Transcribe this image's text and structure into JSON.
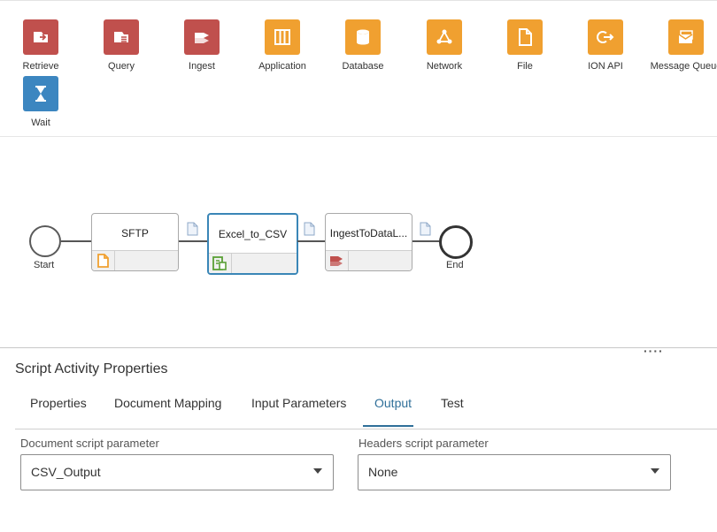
{
  "palette": {
    "items": [
      {
        "label": "Retrieve",
        "icon": "retrieve-icon",
        "color": "#c0504d"
      },
      {
        "label": "Query",
        "icon": "query-icon",
        "color": "#c0504d"
      },
      {
        "label": "Ingest",
        "icon": "ingest-icon",
        "color": "#c0504d"
      },
      {
        "label": "Application",
        "icon": "application-icon",
        "color": "#f0a030"
      },
      {
        "label": "Database",
        "icon": "database-icon",
        "color": "#f0a030"
      },
      {
        "label": "Network",
        "icon": "network-icon",
        "color": "#f0a030"
      },
      {
        "label": "File",
        "icon": "file-icon",
        "color": "#f0a030"
      },
      {
        "label": "ION API",
        "icon": "ion-api-icon",
        "color": "#f0a030"
      },
      {
        "label": "Message Queue",
        "icon": "message-queue-icon",
        "color": "#f0a030"
      },
      {
        "label": "Wait",
        "icon": "hourglass-icon",
        "color": "#3c86c0"
      }
    ]
  },
  "flow": {
    "start_label": "Start",
    "end_label": "End",
    "activities": [
      {
        "title": "SFTP",
        "icon": "file-connector-icon",
        "icon_color": "#f0a030"
      },
      {
        "title": "Excel_to_CSV",
        "icon": "script-icon",
        "icon_color": "#5aa036",
        "selected": true
      },
      {
        "title": "IngestToDataL...",
        "icon": "ingest-icon",
        "icon_color": "#c0504d"
      }
    ]
  },
  "properties": {
    "title": "Script Activity Properties",
    "tabs": [
      "Properties",
      "Document Mapping",
      "Input Parameters",
      "Output",
      "Test"
    ],
    "active_tab": "Output",
    "document_param": {
      "label": "Document script parameter",
      "value": "CSV_Output"
    },
    "headers_param": {
      "label": "Headers script parameter",
      "value": "None"
    }
  },
  "colors": {
    "accent": "#2f6f99",
    "selected_border": "#3a86b7"
  }
}
